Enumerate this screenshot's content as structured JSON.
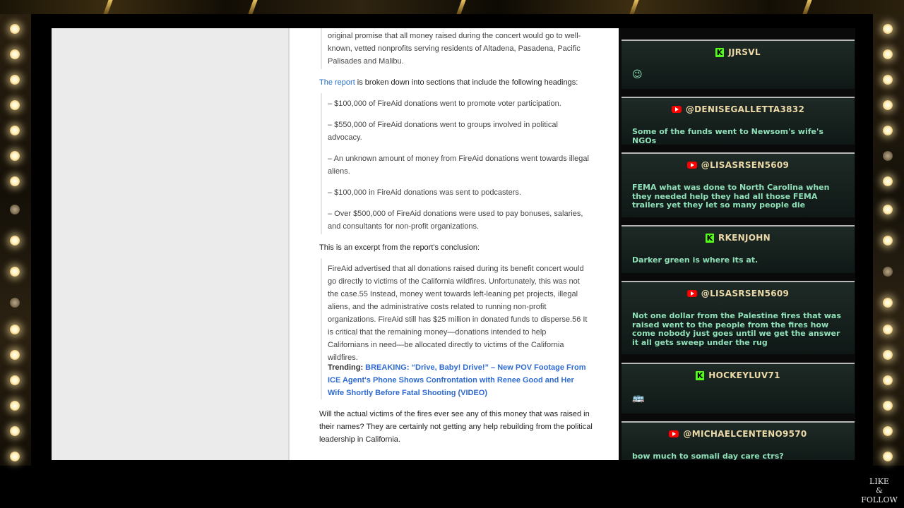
{
  "article": {
    "intro_quote": "original promise that all money raised during the concert would go to well-known, vetted nonprofits serving residents of Altadena, Pasadena, Pacific Palisades and Malibu.",
    "report_link": "The report",
    "report_sentence": " is broken down into sections that include the following headings:",
    "headings": [
      "– $100,000 of FireAid donations went to promote voter participation.",
      "– $550,000 of FireAid donations went to groups involved in political advocacy.",
      "– An unknown amount of money from FireAid donations went towards illegal aliens.",
      "– $100,000 in FireAid donations was sent to podcasters.",
      "– Over $500,000 of FireAid donations were used to pay bonuses, salaries, and consultants for non-profit organizations."
    ],
    "excerpt_intro": "This is an excerpt from the report's conclusion:",
    "conclusion_quote": "FireAid advertised that all donations raised during its benefit concert would go directly to victims of the California wildfires. Unfortunately, this was not the case.55 Instead, money went towards left-leaning pet projects, illegal aliens, and the administrative costs related to running non-profit organizations. FireAid still has $25 million in donated funds to disperse.56 It is critical that the remaining money—donations intended to help Californians in need—be allocated directly to victims of the California wildfires.",
    "trending_label": "Trending: ",
    "trending_link": "BREAKING: “Drive, Baby! Drive!” – New POV Footage From ICE Agent's Phone Shows Confrontation with Renee Good and Her Wife Shortly Before Fatal Shooting (VIDEO)",
    "closing": "Will the actual victims of the fires ever see any of this money that was raised in their names? They are certainly not getting any help rebuilding from the political leadership in California."
  },
  "chat": {
    "messages": [
      {
        "platform": "kick",
        "icon": "kick-icon",
        "user": "JJRSVL",
        "text": "😉"
      },
      {
        "platform": "youtube",
        "icon": "youtube-icon",
        "user": "@DENISEGALLETTA3832",
        "text": "Some of the funds went to Newsom's wife's NGOs"
      },
      {
        "platform": "youtube",
        "icon": "youtube-icon",
        "user": "@LISASRSEN5609",
        "text": "FEMA what was done to North Carolina when they needed help they had all those FEMA trailers yet they let so many people die"
      },
      {
        "platform": "kick",
        "icon": "kick-icon",
        "user": "RKENJOHN",
        "text": "Darker green is where its at."
      },
      {
        "platform": "youtube",
        "icon": "youtube-icon",
        "user": "@LISASRSEN5609",
        "text": "Not one dollar from the Palestine fires that was raised went to the people from the fires how come nobody just goes until we get the answer it all gets sweep under the rug"
      },
      {
        "platform": "kick",
        "icon": "kick-icon",
        "user": "HOCKEYLUV71",
        "text": "🚌"
      },
      {
        "platform": "youtube",
        "icon": "youtube-icon",
        "user": "@MICHAELCENTENO9570",
        "text": "bow much to somali day care ctrs?"
      }
    ]
  },
  "overlay": {
    "like_follow": [
      "LIKE",
      "&",
      "FOLLOW"
    ]
  },
  "colors": {
    "chat_username": "#ecd9a8",
    "chat_text": "#8fe0b8",
    "link_blue": "#2a6fbf",
    "kick_green": "#53fc18",
    "youtube_red": "#ff0000"
  }
}
